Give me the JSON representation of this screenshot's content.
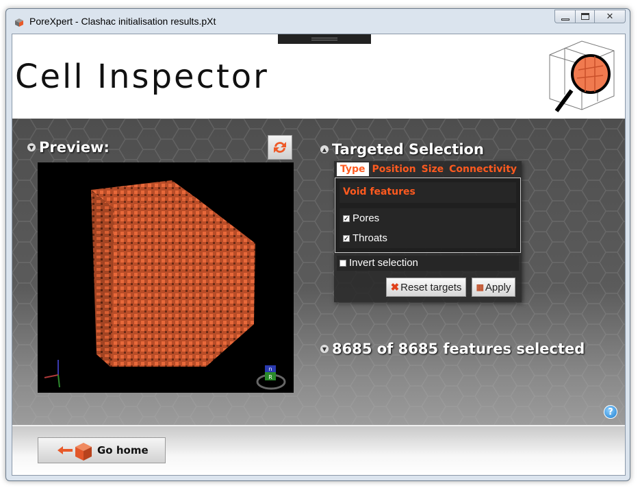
{
  "window": {
    "title": "PoreXpert - Clashac initialisation results.pXt",
    "controls": {
      "minimize": "minimize",
      "maximize": "maximize",
      "close": "close"
    }
  },
  "header": {
    "page_title": "Cell Inspector",
    "logo_icon": "cube-magnifier-icon"
  },
  "preview": {
    "heading": "Preview:",
    "refresh_icon": "refresh-arrows-icon",
    "nav_cube_label_top": "n",
    "nav_cube_label_front": "R"
  },
  "targeted_selection": {
    "heading": "Targeted Selection",
    "tabs": [
      {
        "label": "Type",
        "active": true
      },
      {
        "label": "Position",
        "active": false
      },
      {
        "label": "Size",
        "active": false
      },
      {
        "label": "Connectivity",
        "active": false
      }
    ],
    "group_heading": "Void features",
    "options": [
      {
        "label": "Pores",
        "checked": true
      },
      {
        "label": "Throats",
        "checked": true
      }
    ],
    "invert": {
      "label": "Invert selection",
      "checked": false
    },
    "reset_label": "Reset targets",
    "apply_label": "Apply"
  },
  "summary": {
    "features_selected": "8685 of 8685 features selected"
  },
  "help": {
    "label": "?"
  },
  "footer": {
    "home_label": "Go home"
  },
  "colors": {
    "accent": "#ff5a1f",
    "background": "#555555"
  }
}
